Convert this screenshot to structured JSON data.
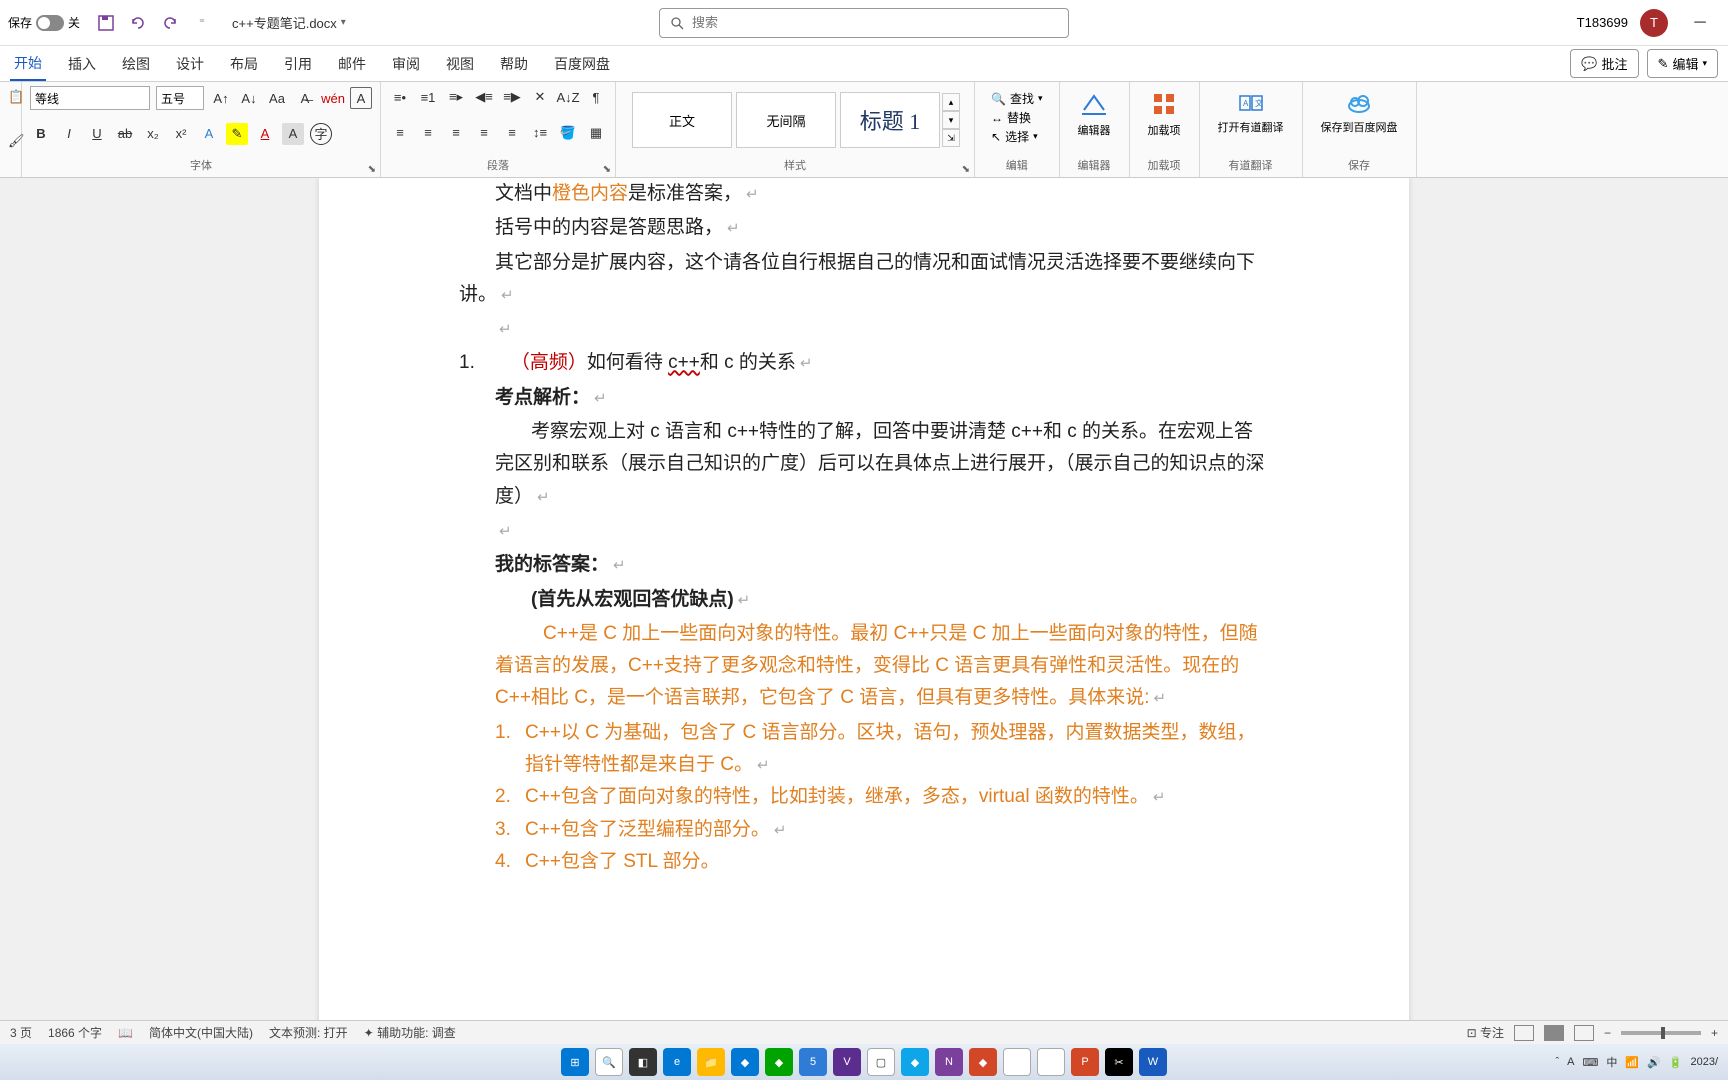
{
  "titlebar": {
    "autosave_label": "保存",
    "autosave_state": "关",
    "filename": "c++专题笔记.docx",
    "search_placeholder": "搜索",
    "username": "T183699",
    "avatar_initial": "T"
  },
  "tabs": {
    "items": [
      "开始",
      "插入",
      "绘图",
      "设计",
      "布局",
      "引用",
      "邮件",
      "审阅",
      "视图",
      "帮助",
      "百度网盘"
    ],
    "active": 0,
    "comments": "批注",
    "edit": "编辑"
  },
  "ribbon": {
    "font_name": "等线",
    "font_size": "五号",
    "group_font": "字体",
    "group_para": "段落",
    "group_styles": "样式",
    "group_edit": "编辑",
    "group_editor": "编辑器",
    "group_addin": "加载项",
    "group_translate": "有道翻译",
    "group_save": "保存",
    "style_normal": "正文",
    "style_nospace": "无间隔",
    "style_h1": "标题 1",
    "find": "查找",
    "replace": "替换",
    "select": "选择",
    "editor_btn": "编辑器",
    "addin_btn": "加载项",
    "translate_btn": "打开有道翻译",
    "save_btn": "保存到百度网盘"
  },
  "doc": {
    "l1a": "文档中",
    "l1b": "橙色内容",
    "l1c": "是标准答案，",
    "l2": "括号中的内容是答题思路，",
    "l3": "其它部分是扩展内容，这个请各位自行根据自己的情况和面试情况灵活选择要不要继续向下讲。",
    "q1_num": "1.",
    "q1_tag": "（高频）",
    "q1_text": "如何看待 ",
    "q1_cpp": "c++",
    "q1_text2": "和 c 的关系",
    "analysis_label": "考点解析：",
    "analysis_body": "考察宏观上对 c 语言和 c++特性的了解，回答中要讲清楚 c++和 c 的关系。在宏观上答完区别和联系（展示自己知识的广度）后可以在具体点上进行展开，（展示自己的知识点的深度）",
    "answer_label": "我的标答案：",
    "answer_hint": "(首先从宏观回答优缺点)",
    "answer_body": "C++是 C 加上一些面向对象的特性。最初 C++只是 C 加上一些面向对象的特性，但随着语言的发展，C++支持了更多观念和特性，变得比 C 语言更具有弹性和灵活性。现在的 C++相比 C，是一个语言联邦，它包含了 C 语言，但具有更多特性。具体来说:",
    "a1_num": "1.",
    "a1": "C++以 C 为基础，包含了 C 语言部分。区块，语句，预处理器，内置数据类型，数组，指针等特性都是来自于 C。",
    "a2_num": "2.",
    "a2": "C++包含了面向对象的特性，比如封装，继承，多态，virtual 函数的特性。",
    "a3_num": "3.",
    "a3": "C++包含了泛型编程的部分。",
    "a4_num": "4.",
    "a4": "C++包含了 STL 部分。"
  },
  "statusbar": {
    "page": "3 页",
    "words": "1866 个字",
    "lang": "简体中文(中国大陆)",
    "predict": "文本预测: 打开",
    "access": "辅助功能: 调查",
    "focus": "专注",
    "date": "2023/"
  }
}
